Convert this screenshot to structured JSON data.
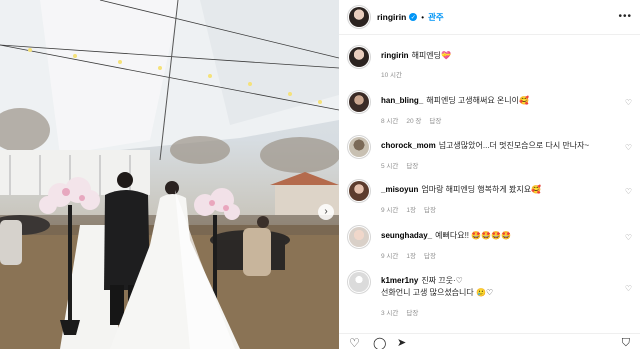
{
  "post": {
    "username": "ringirin",
    "follow_label": "관주",
    "caption_text": "해피엔딩",
    "caption_emoji": "💝",
    "caption_time": "10 시간"
  },
  "comments": [
    {
      "username": "han_bling_",
      "text": "해피엔딩 고생해써요 온니이🥰",
      "time": "8 시간",
      "likes": "20 장",
      "reply": "답장"
    },
    {
      "username": "chorock_mom",
      "text": "넘고생많았어...더 멋진모습으로 다시 만나자~",
      "time": "5 시간",
      "likes": "",
      "reply": "답장"
    },
    {
      "username": "_misoyun",
      "text": "엄마랑 해피엔딩 행복하게 봤지요🥰",
      "time": "9 시간",
      "likes": "1장",
      "reply": "답장"
    },
    {
      "username": "seunghaday_",
      "text": "예뻐다요!! 🤩🤩🤩🤩",
      "time": "9 시간",
      "likes": "1장",
      "reply": "답장"
    },
    {
      "username": "k1mer1ny",
      "text": "진짜 끄웃·♡\n선화언니 고생 많으셨습니다 🥲♡",
      "time": "3 시간",
      "likes": "",
      "reply": "답장"
    }
  ],
  "icons": {
    "heart": "heart-icon",
    "comment": "comment-icon",
    "share": "share-icon",
    "bookmark": "bookmark-icon",
    "more": "more-icon",
    "verified": "verified-icon",
    "next": "carousel-next-icon"
  },
  "colors": {
    "accent": "#0095f6",
    "muted": "#8e8e8e",
    "text": "#262626"
  }
}
